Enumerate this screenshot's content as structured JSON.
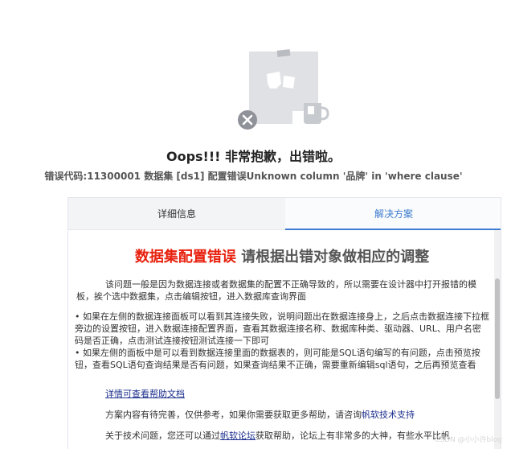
{
  "error": {
    "headline": "Oops!!! 非常抱歉，出错啦。",
    "code_line": "错误代码:11300001 数据集 [ds1] 配置错误Unknown column '品牌' in 'where clause'"
  },
  "tabs": [
    {
      "label": "详细信息",
      "active": false
    },
    {
      "label": "解决方案",
      "active": true
    }
  ],
  "solution": {
    "title_red": "数据集配置错误",
    "title_gray": " 请根据出错对象做相应的调整",
    "intro": "该问题一般是因为数据连接或者数据集的配置不正确导致的，所以需要在设计器中打开报错的模板，挨个选中数据集，点击编辑按钮，进入数据库查询界面",
    "bullets": [
      "•  如果在左侧的数据连接面板可以看到其连接失败，说明问题出在数据连接身上，之后点击数据连接下拉框旁边的设置按钮，进入数据连接配置界面，查看其数据连接名称、数据库种类、驱动器、URL、用户名密码是否正确，点击测试连接按钮测试连接一下即可",
      "•  如果左侧的面板中是可以看到数据连接里面的数据表的，则可能是SQL语句编写的有问题，点击预览按钮，查看SQL语句查询结果是否有问题，如果查询结果不正确，需要重新编辑sql语句，之后再预览查看"
    ],
    "help_link": "详情可查看帮助文档",
    "note_prefix": "方案内容有待完善，仅供参考，如果你需要获取更多帮助，请咨询",
    "note_link": "帆软技术支持",
    "forum_prefix": "关于技术问题，您还可以通过",
    "forum_link": "帆软论坛",
    "forum_suffix": "获取帮助，论坛上有非常多的大神，有些水平比帆"
  },
  "watermark": "CSDN @小小许blog",
  "icons": {
    "illustration": "error-illustration",
    "close": "close-circle-icon"
  }
}
